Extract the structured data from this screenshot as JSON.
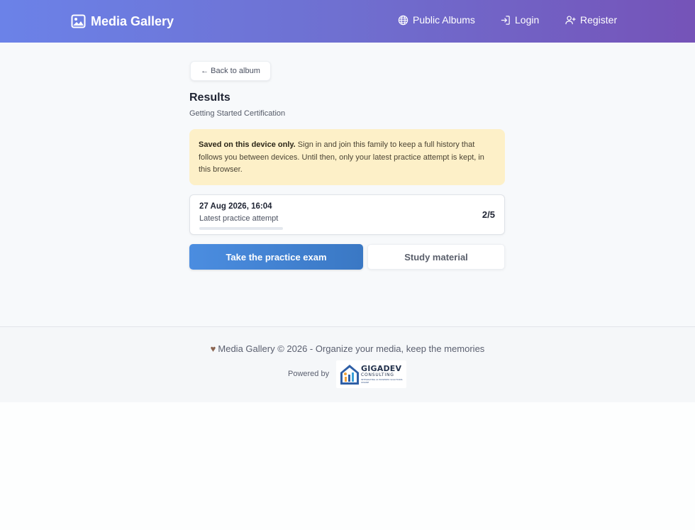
{
  "header": {
    "brand": "Media Gallery",
    "nav": {
      "public_albums": "Public Albums",
      "login": "Login",
      "register": "Register"
    }
  },
  "main": {
    "back_label": "← Back to album",
    "title": "Results",
    "subtitle": "Getting Started Certification",
    "notice": {
      "bold": "Saved on this device only.",
      "text": " Sign in and join this family to keep a full history that follows you between devices. Until then, only your latest practice attempt is kept, in this browser."
    },
    "attempt": {
      "date": "27 Aug 2026, 16:04",
      "label": "Latest practice attempt",
      "score": "2/5",
      "progress": 0.0
    },
    "primary_button": "Take the practice exam",
    "secondary_button": "Study material"
  },
  "footer": {
    "text": "Media Gallery © 2026 - Organize your media, keep the memories",
    "powered_by": "Powered by",
    "logo": {
      "name": "GIGADEV",
      "sub": "CONSULTING",
      "tagline": "INTEGRATING AI POWERED SOLUTIONS ONLINE"
    }
  },
  "colors": {
    "header_gradient_start": "#6b82e8",
    "header_gradient_end": "#7553b8",
    "notice_bg": "#fdf0c8",
    "primary_button": "#4b8de0"
  },
  "icons": {
    "brand": "image-icon",
    "public_albums": "globe-icon",
    "login": "login-icon",
    "register": "user-plus-icon",
    "footer": "heart-icon"
  }
}
